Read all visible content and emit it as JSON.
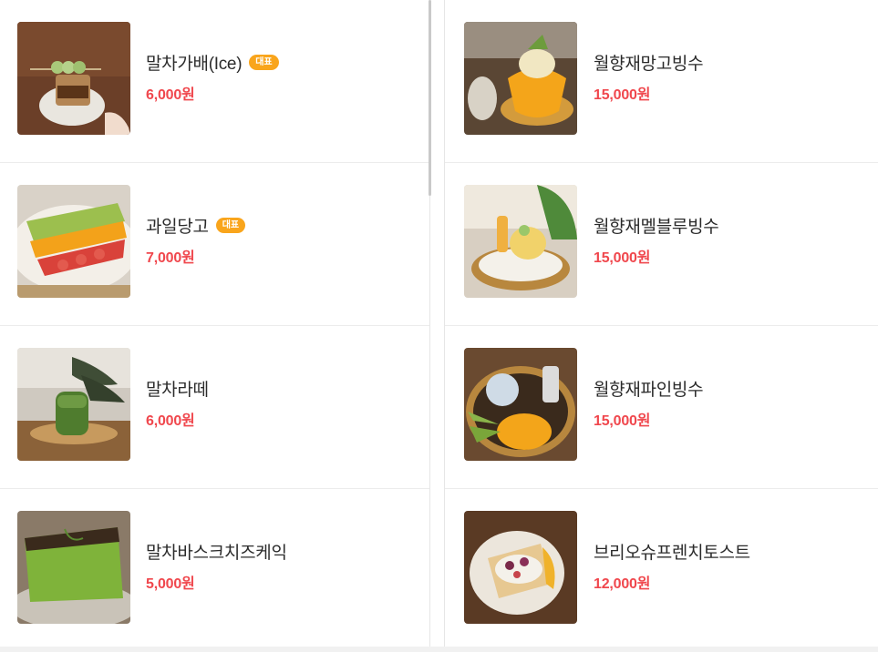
{
  "left_column": [
    {
      "name": "말차가배(Ice)",
      "badge": "대표",
      "price": "6,000원",
      "image": "matcha-dango-cup-photo"
    },
    {
      "name": "과일당고",
      "badge": "대표",
      "price": "7,000원",
      "image": "fruit-skewer-photo"
    },
    {
      "name": "말차라떼",
      "badge": "",
      "price": "6,000원",
      "image": "matcha-latte-photo"
    },
    {
      "name": "말차바스크치즈케익",
      "badge": "",
      "price": "5,000원",
      "image": "matcha-basque-cheesecake-photo"
    }
  ],
  "right_column": [
    {
      "name": "월향재망고빙수",
      "badge": "",
      "price": "15,000원",
      "image": "mango-bingsu-photo"
    },
    {
      "name": "월향재멜블루빙수",
      "badge": "",
      "price": "15,000원",
      "image": "melon-blue-bingsu-photo"
    },
    {
      "name": "월향재파인빙수",
      "badge": "",
      "price": "15,000원",
      "image": "pineapple-bingsu-photo"
    },
    {
      "name": "브리오슈프렌치토스트",
      "badge": "",
      "price": "12,000원",
      "image": "brioche-french-toast-photo"
    }
  ],
  "colors": {
    "price": "#f0474d",
    "badge": "#f9a51c",
    "name": "#2b2b2b"
  }
}
